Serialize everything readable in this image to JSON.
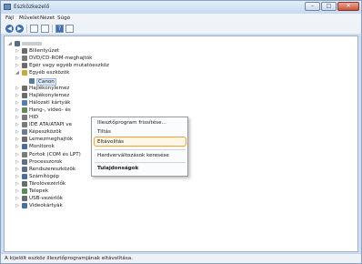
{
  "window": {
    "title": "Eszközkezelő",
    "buttons": {
      "minimize": "–",
      "maximize": "□",
      "close": "✕"
    }
  },
  "menubar": {
    "items": [
      "Fájl",
      "Művelet",
      "Nézet",
      "Súgó"
    ]
  },
  "toolbar": {
    "back": "◀",
    "forward": "▶",
    "help": "?"
  },
  "tree": {
    "rows": [
      {
        "label": "",
        "icon": "computer-icon",
        "expander": "◢",
        "color": "#5a6c84"
      },
      {
        "label": "Billentyűzet",
        "icon": "keyboard-icon",
        "expander": "▷",
        "color": "#6b6b6b"
      },
      {
        "label": "DVD/CD-ROM-meghajtók",
        "icon": "disc-drive-icon",
        "expander": "▷",
        "color": "#7a7a7a"
      },
      {
        "label": "Egér vagy egyéb mutatóeszköz",
        "icon": "mouse-icon",
        "expander": "▷",
        "color": "#6b6b6b"
      },
      {
        "label": "Egyéb eszközök",
        "icon": "other-devices-icon",
        "expander": "◢",
        "color": "#c9a640"
      },
      {
        "label": "Canon",
        "icon": "printer-icon",
        "expander": "",
        "color": "#5c7a99"
      },
      {
        "label": "Hajlékonylemez",
        "icon": "floppy-icon",
        "expander": "▷",
        "color": "#6b6b6b"
      },
      {
        "label": "Hajlékonylemez",
        "icon": "floppy-drive-icon",
        "expander": "▷",
        "color": "#6b6b6b"
      },
      {
        "label": "Hálózati kártyák",
        "icon": "network-icon",
        "expander": "▷",
        "color": "#4f7fb0"
      },
      {
        "label": "Hang-, videó- és",
        "icon": "sound-icon",
        "expander": "▷",
        "color": "#5f8a5a"
      },
      {
        "label": "HID",
        "icon": "hid-icon",
        "expander": "▷",
        "color": "#7a7a7a"
      },
      {
        "label": "IDE ATA/ATAPI ve",
        "icon": "ide-icon",
        "expander": "▷",
        "color": "#7a7a7a"
      },
      {
        "label": "Képeszközök",
        "icon": "camera-icon",
        "expander": "▷",
        "color": "#6a7d94"
      },
      {
        "label": "Lemezmeghajtók",
        "icon": "disk-icon",
        "expander": "▷",
        "color": "#6b6b6b"
      },
      {
        "label": "Monitorok",
        "icon": "monitor-icon",
        "expander": "▷",
        "color": "#4a6e9a"
      },
      {
        "label": "Portok (COM és LPT)",
        "icon": "port-icon",
        "expander": "▷",
        "color": "#7a7a7a"
      },
      {
        "label": "Processzorok",
        "icon": "processor-icon",
        "expander": "▷",
        "color": "#5c6f88"
      },
      {
        "label": "Rendszereszközök",
        "icon": "system-icon",
        "expander": "▷",
        "color": "#5c6f88"
      },
      {
        "label": "Számítógép",
        "icon": "computer-icon",
        "expander": "▷",
        "color": "#4a6e9a"
      },
      {
        "label": "Tárolóvezérlők",
        "icon": "storage-icon",
        "expander": "▷",
        "color": "#6b6b6b"
      },
      {
        "label": "Telepek",
        "icon": "battery-icon",
        "expander": "▷",
        "color": "#5f8a5a"
      },
      {
        "label": "USB-vezérlők",
        "icon": "usb-icon",
        "expander": "▷",
        "color": "#6b6b6b"
      },
      {
        "label": "Videokártyák",
        "icon": "display-adapter-icon",
        "expander": "▷",
        "color": "#4a6e9a"
      }
    ]
  },
  "context_menu": {
    "update_driver": "Illesztőprogram frissítése...",
    "disable": "Tiltás",
    "uninstall": "Eltávolítás",
    "scan_hardware": "Hardverváltozások keresése",
    "properties": "Tulajdonságok"
  },
  "status": {
    "text": "A kijelölt eszköz illesztőprogramjának eltávolítása."
  },
  "colors": {
    "highlight_border": "#f0a137",
    "selection": "#dde9f7"
  }
}
